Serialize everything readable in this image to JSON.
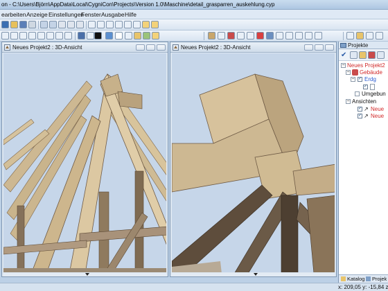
{
  "window": {
    "title": "on - C:\\Users\\Björn\\AppData\\Local\\CygniCon\\Projects\\Version 1.0\\Maschine\\detail_grasparren_auskehlung.cyp"
  },
  "menu": {
    "items": [
      "earbeiten",
      "Anzeige",
      "Einstellungen",
      "Fenster",
      "Ausgabe",
      "Hilfe"
    ]
  },
  "viewports": {
    "left": {
      "title": "Neues Projekt2 : 3D-Ansicht"
    },
    "right": {
      "title": "Neues Projekt2 : 3D-Ansicht"
    }
  },
  "panel": {
    "title": "Projekte",
    "tree": {
      "project": "Neues Projekt2",
      "building": "Gebäude",
      "floor": "Erdg",
      "environment": "Umgebun",
      "views": "Ansichten",
      "view1": "Neue",
      "view2": "Neue"
    },
    "tabs": {
      "catalog": "Katalog",
      "projects": "Projek"
    }
  },
  "status": {
    "coords": "x: 209,05 y: -15,84 z"
  },
  "colors": {
    "sky": "#c6d6e9",
    "wood_light": "#d9c6a1",
    "wood_dark": "#6e5a45",
    "accent_red": "#d12a2a"
  }
}
